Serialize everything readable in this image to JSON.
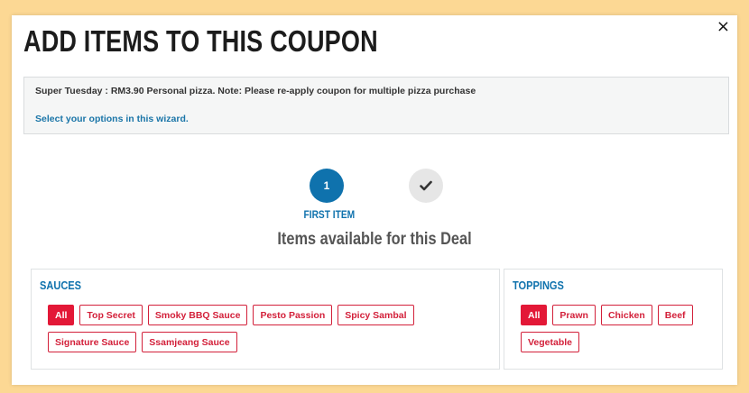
{
  "modal": {
    "title": "ADD ITEMS TO THIS COUPON",
    "close_label": "×"
  },
  "info": {
    "description": "Super Tuesday : RM3.90 Personal pizza. Note: Please re-apply coupon for multiple pizza purchase",
    "hint": "Select your options in this wizard."
  },
  "wizard": {
    "step1_number": "1",
    "step1_label": "FIRST ITEM",
    "step2_icon": "check-icon",
    "subtitle": "Items available for this Deal"
  },
  "sauces": {
    "title": "SAUCES",
    "filters": [
      "All",
      "Top Secret",
      "Smoky BBQ Sauce",
      "Pesto Passion",
      "Spicy Sambal",
      "Signature Sauce",
      "Ssamjeang Sauce"
    ],
    "selected": "All"
  },
  "toppings": {
    "title": "TOPPINGS",
    "filters": [
      "All",
      "Prawn",
      "Chicken",
      "Beef",
      "Vegetable"
    ],
    "selected": "All"
  },
  "colors": {
    "background": "#fcd894",
    "accent_blue": "#0f72ad",
    "accent_red": "#e31837"
  }
}
